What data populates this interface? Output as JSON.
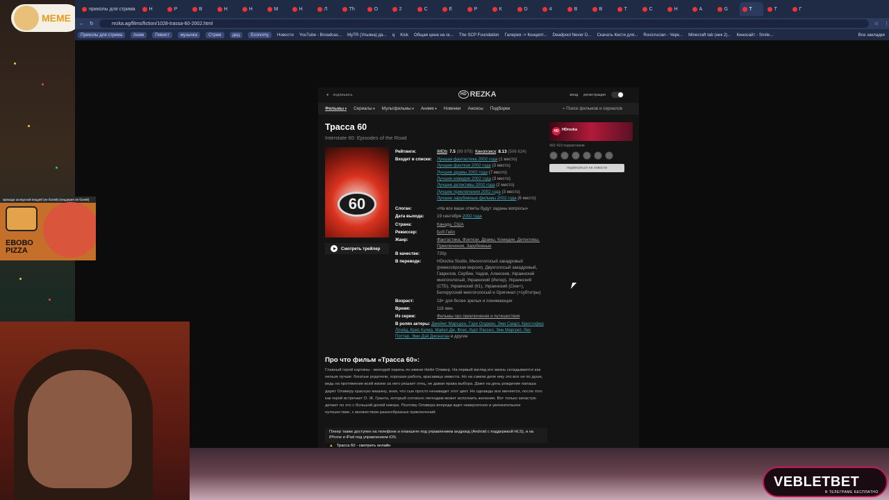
{
  "browser": {
    "tabs": [
      {
        "label": "приколы для стрима"
      },
      {
        "label": "Н"
      },
      {
        "label": "Р"
      },
      {
        "label": "В"
      },
      {
        "label": "Н"
      },
      {
        "label": "Н"
      },
      {
        "label": "М"
      },
      {
        "label": "Н"
      },
      {
        "label": "Л"
      },
      {
        "label": "Th"
      },
      {
        "label": "О"
      },
      {
        "label": "2"
      },
      {
        "label": "С"
      },
      {
        "label": "Е"
      },
      {
        "label": "Р"
      },
      {
        "label": "К"
      },
      {
        "label": "D"
      },
      {
        "label": "4"
      },
      {
        "label": "В"
      },
      {
        "label": "В"
      },
      {
        "label": "Т"
      },
      {
        "label": "С"
      },
      {
        "label": "Н"
      },
      {
        "label": "А"
      },
      {
        "label": "G"
      },
      {
        "label": "Т"
      },
      {
        "label": "Т"
      },
      {
        "label": "Г"
      }
    ],
    "url": "rezka.ag/films/fiction/1028-trassa-60-2002.html",
    "bookmarks": [
      "Приколы для стрима",
      "Аним",
      "Пивист",
      "музычка",
      "Стрим",
      "дед",
      "Economy",
      "Новости",
      "YouTube - Broadcas...",
      "MyTR (Ульяна) да...",
      "q",
      "Kick",
      "Общая цена на ск...",
      "The SCP Foundation",
      "Галерея -> Концепт...",
      "Deadpool Never D...",
      "Скачать Кисти для...",
      "Rosicrucian - Черк...",
      "Minecraft tab (ник 2)...",
      "Киносайт - Smile..."
    ],
    "all_bookmarks": "Все закладки"
  },
  "stream": {
    "meme_label": "МЕМЕ",
    "ad_top": "приходи за вкусной пиццей (не болей) (пиццерия не болей)",
    "ad_brand_line1": "ЕВОВО",
    "ad_brand_line2": "PIZZA",
    "veblet": "VEBLETBET",
    "veblet_sub": "В ТЕЛЕГРАМЕ БЕСПЛАТНО"
  },
  "site": {
    "top_left": "подпишись",
    "logo": "REZKA",
    "logo_hd": "HD",
    "login": "вход",
    "register": "регистрация",
    "nav": {
      "films": "Фильмы",
      "series": "Сериалы",
      "cartoons": "Мультфильмы",
      "anime": "Аниме",
      "new": "Новинки",
      "announce": "Анонсы",
      "collections": "Подборки",
      "search": "Поиск фильмов и сериалов"
    },
    "movie": {
      "title": "Трасса 60",
      "original": "Interstate 60: Episodes of the Road",
      "trailer": "Смотреть трейлер",
      "poster_number": "60",
      "ratings_label": "Рейтинги:",
      "imdb_label": "IMDb",
      "imdb_value": "7.5",
      "imdb_votes": "(99 979)",
      "kp_label": "Кинопоиск",
      "kp_value": "8.13",
      "kp_votes": "(506 624)",
      "lists_label": "Входит в списки:",
      "lists": [
        {
          "link": "Лучшая фантастика 2002 года",
          "place": "(1 место)"
        },
        {
          "link": "Лучшие фэнтези 2002 года",
          "place": "(3 место)"
        },
        {
          "link": "Лучшие драмы 2002 года",
          "place": "(7 место)"
        },
        {
          "link": "Лучшие комедии 2002 года",
          "place": "(3 место)"
        },
        {
          "link": "Лучшие детективы 2002 года",
          "place": "(2 место)"
        },
        {
          "link": "Лучшие приключения 2002 года",
          "place": "(3 место)"
        },
        {
          "link": "Лучшие зарубежные фильмы 2002 года",
          "place": "(6 место)"
        }
      ],
      "slogan_label": "Слоган:",
      "slogan": "«На все ваши ответы будут заданы вопросы»",
      "release_label": "Дата выхода:",
      "release_day": "19 сентября",
      "release_year": "2002 года",
      "country_label": "Страна:",
      "country": "Канада, США",
      "director_label": "Режиссер:",
      "director": "Боб Гейл",
      "genre_label": "Жанр:",
      "genre": "Фантастика, Фэнтези, Драмы, Комедии, Детективы, Приключения, Зарубежные",
      "quality_label": "В качестве:",
      "quality": "720p",
      "translation_label": "В переводе:",
      "translation": "HDrezka Studio, Многоголосый закадровый (режиссёрская версия), Двухголосый закадровый, Гаврилов, Сербин, Чадов, Алексеев, Украинский многоголосый, Украинский (Интер), Украинский (СТБ), Украинский (К1), Украинский (Сіне+), Белорусский многоголосый и Оригинал (+субтитры)",
      "age_label": "Возраст:",
      "age": "18+ для более зрелых и понимающих",
      "time_label": "Время:",
      "time": "116 мин.",
      "series_label": "Из серии:",
      "series_link": "Фильмы про приключения и путешествия",
      "actors_label": "В ролях актеры:",
      "actors": "Джеймс Марсден, Гэри Олдман, Эми Смарт, Кристофер Ллойд, Крис Купер, Майкл Дж. Фокс, Курт Рассел, Энн Маргрет, Лес Поттер, Эми Дэй Джонатан",
      "actors_more": "и другие",
      "desc_title": "Про что фильм «Трасса 60»:",
      "description": "Главный герой картины - молодой парень по имени Нейл Оливер. На первый взгляд его жизнь складывается как нельзя лучше: богатые родители, хорошая работа, красавица невеста. Но на самом деле ему это все не по душе, ведь на протяжении всей жизни за него решает отец, не давая права выбора. Даже на день рождение папаша дарит Оливеру красную машину, зная, что сын просто ненавидит этот цвет. Но однажды все меняется, после того как герой встречает О. Ж. Гранта, который согласно легендам может исполнить желания. Вот только зачастую делает он это с большой долей юмора. Поэтому Оливера впереди ждет невероятное и увлекательное путешествие, с множеством разнообразных приключений.",
      "player_note": "Плеер также доступен на телефоне и планшете под управлением андроид (Android с поддержкой HLS), и на iPhone и iPad под управлением iOS.",
      "watch_strip": "Трасса 60 - смотреть онлайн"
    },
    "sidebar": {
      "banner": "HDrezka",
      "subscribers": "492 419 подписчиков",
      "subscribe_button": "подписаться на новости"
    }
  },
  "colors": {
    "link": "#4aa7b8",
    "tabbar": "#1f2a44",
    "site_bg": "#141414"
  }
}
